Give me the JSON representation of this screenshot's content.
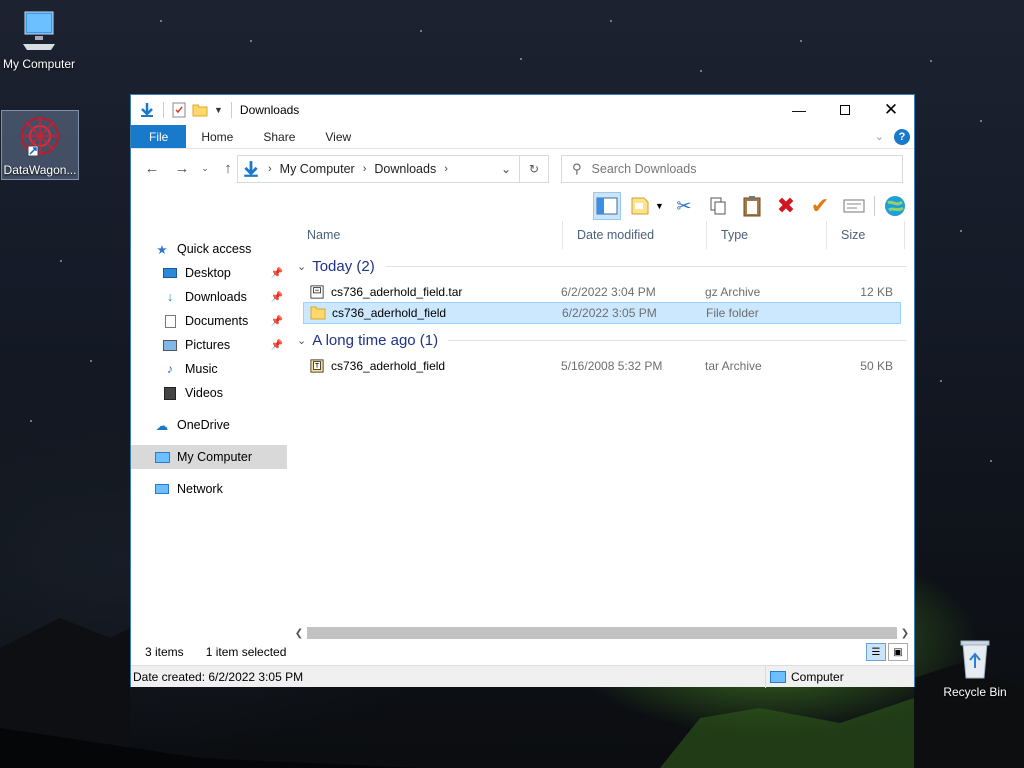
{
  "desktop": {
    "icons": [
      {
        "label": "My Computer"
      },
      {
        "label": "DataWagon..."
      },
      {
        "label": "Recycle Bin"
      }
    ]
  },
  "window": {
    "title": "Downloads",
    "ribbon_tabs": [
      "File",
      "Home",
      "Share",
      "View"
    ],
    "address": {
      "crumbs": [
        "My Computer",
        "Downloads"
      ]
    },
    "search_placeholder": "Search Downloads",
    "columns": [
      "Name",
      "Date modified",
      "Type",
      "Size"
    ],
    "nav": {
      "quick_access": "Quick access",
      "items": [
        "Desktop",
        "Downloads",
        "Documents",
        "Pictures",
        "Music",
        "Videos"
      ],
      "onedrive": "OneDrive",
      "my_computer": "My Computer",
      "network": "Network"
    },
    "groups": [
      {
        "title": "Today (2)",
        "files": [
          {
            "name": "cs736_aderhold_field.tar",
            "date": "6/2/2022 3:04 PM",
            "type": "gz Archive",
            "size": "12 KB"
          },
          {
            "name": "cs736_aderhold_field",
            "date": "6/2/2022 3:05 PM",
            "type": "File folder",
            "size": ""
          }
        ]
      },
      {
        "title": "A long time ago (1)",
        "files": [
          {
            "name": "cs736_aderhold_field",
            "date": "5/16/2008 5:32 PM",
            "type": "tar Archive",
            "size": "50 KB"
          }
        ]
      }
    ],
    "status": {
      "items": "3 items",
      "selected": "1 item selected"
    },
    "details": {
      "date_created": "Date created: 6/2/2022 3:05 PM",
      "location": "Computer"
    }
  },
  "colors": {
    "accent": "#1979ca",
    "selection": "#cce8ff",
    "group_title": "#1e3287"
  }
}
